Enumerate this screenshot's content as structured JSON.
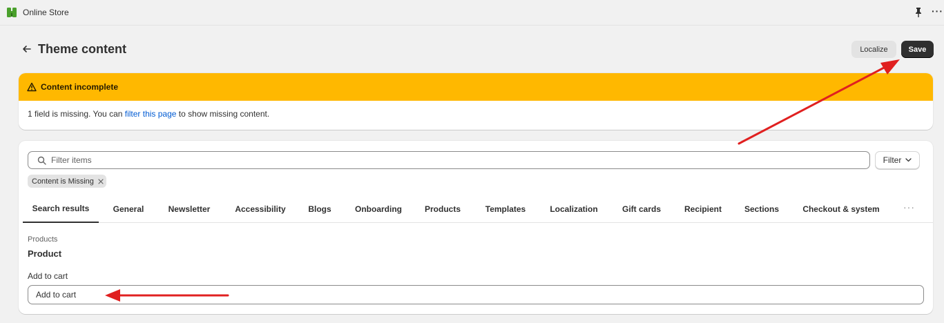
{
  "app": {
    "title": "Online Store",
    "logo_icon": "shopify-bag-icon",
    "pin_icon": "pin-icon",
    "more_icon": "ellipsis-icon",
    "more_text": "···"
  },
  "header": {
    "title": "Theme content",
    "back_icon": "arrow-left-icon",
    "localize_label": "Localize",
    "save_label": "Save"
  },
  "banner": {
    "title": "Content incomplete",
    "icon": "warning-icon",
    "message_before": "1 field is missing. You can ",
    "link_text": "filter this page",
    "message_after": " to show missing content.",
    "background_color": "#ffb800",
    "link_color": "#005bd3"
  },
  "search": {
    "placeholder": "Filter items",
    "value": "",
    "filter_label": "Filter",
    "active_filter_chip": "Content is Missing"
  },
  "tabs": [
    {
      "label": "Search results",
      "active": true
    },
    {
      "label": "General",
      "active": false
    },
    {
      "label": "Newsletter",
      "active": false
    },
    {
      "label": "Accessibility",
      "active": false
    },
    {
      "label": "Blogs",
      "active": false
    },
    {
      "label": "Onboarding",
      "active": false
    },
    {
      "label": "Products",
      "active": false
    },
    {
      "label": "Templates",
      "active": false
    },
    {
      "label": "Localization",
      "active": false
    },
    {
      "label": "Gift cards",
      "active": false
    },
    {
      "label": "Recipient",
      "active": false
    },
    {
      "label": "Sections",
      "active": false
    },
    {
      "label": "Checkout & system",
      "active": false
    }
  ],
  "tabs_more_text": "···",
  "content": {
    "section_label": "Products",
    "section_title": "Product",
    "field_label": "Add to cart",
    "field_value": "Add to cart"
  },
  "annotations": {
    "arrow_color": "#e02020"
  }
}
